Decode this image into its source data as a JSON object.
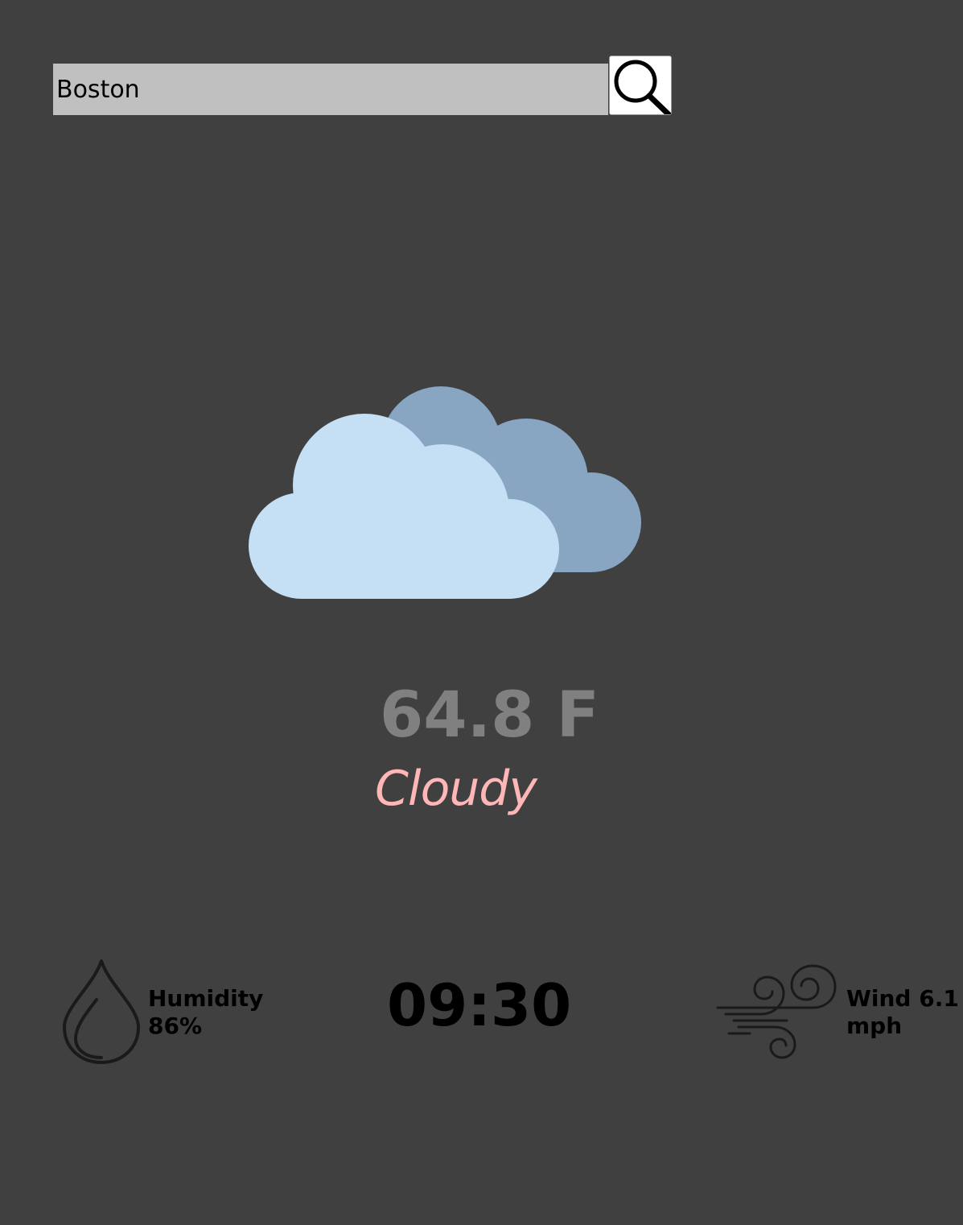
{
  "search": {
    "value": "Boston",
    "button_icon": "search-icon"
  },
  "weather": {
    "icon": "cloudy-icon",
    "temperature": "64.8 F",
    "condition": "Cloudy"
  },
  "humidity": {
    "icon": "water-drop-icon",
    "label": "Humidity",
    "value": "86%"
  },
  "clock": {
    "time": "09:30"
  },
  "wind": {
    "icon": "wind-icon",
    "label": "Wind 6.1",
    "unit": "mph"
  },
  "colors": {
    "background": "#404040",
    "search_field": "#c0c0c0",
    "temperature": "#808080",
    "condition": "#ffb6b6",
    "cloud_back": "#88a5c2",
    "cloud_front": "#c5dff4"
  }
}
